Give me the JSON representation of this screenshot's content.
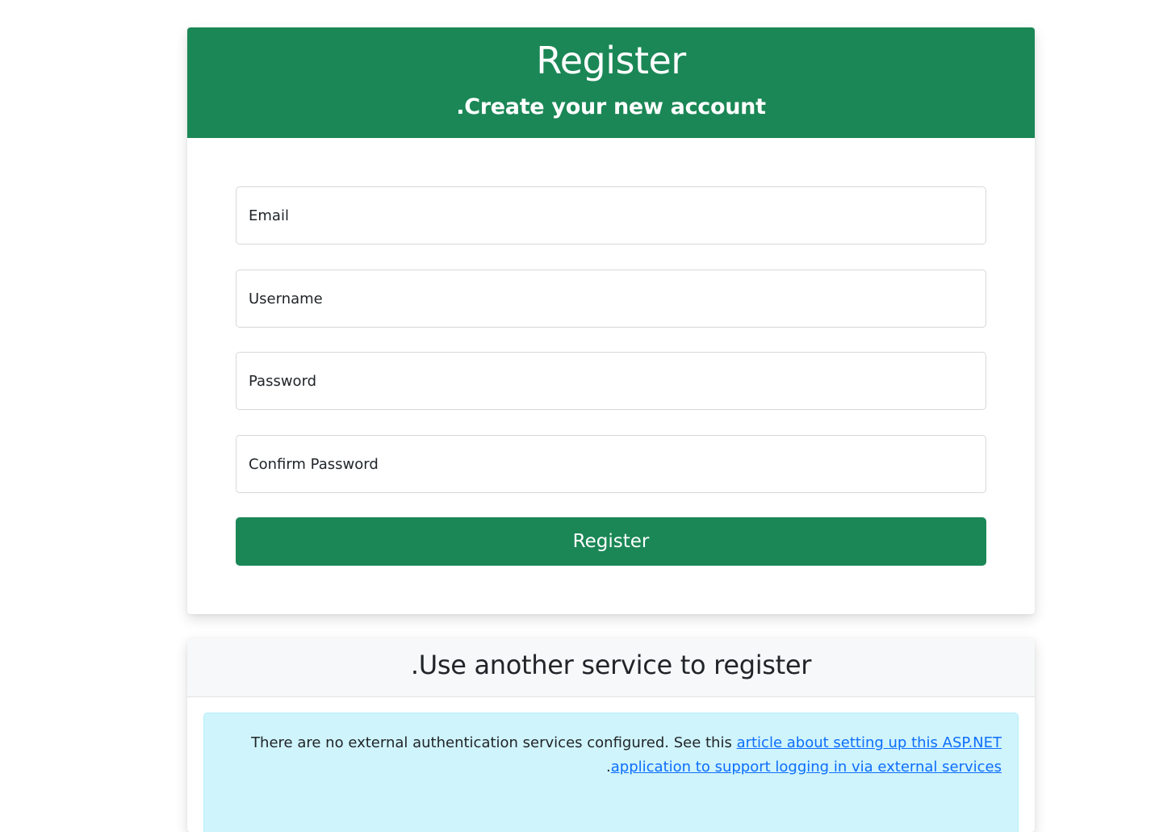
{
  "register_card": {
    "title": "Register",
    "subtitle": ".Create your new account",
    "fields": {
      "email_placeholder": "Email",
      "username_placeholder": "Username",
      "password_placeholder": "Password",
      "confirm_password_placeholder": "Confirm Password"
    },
    "submit_label": "Register"
  },
  "external_card": {
    "title": ".Use another service to register",
    "alert": {
      "text_before": "There are no external authentication services configured. See this ",
      "link_text": "article about setting up this ASP.NET application to support logging in via external services",
      "text_after": "."
    }
  },
  "colors": {
    "primary_green": "#1b8756",
    "info_background": "#cff4fc",
    "link_blue": "#0d6efd"
  }
}
